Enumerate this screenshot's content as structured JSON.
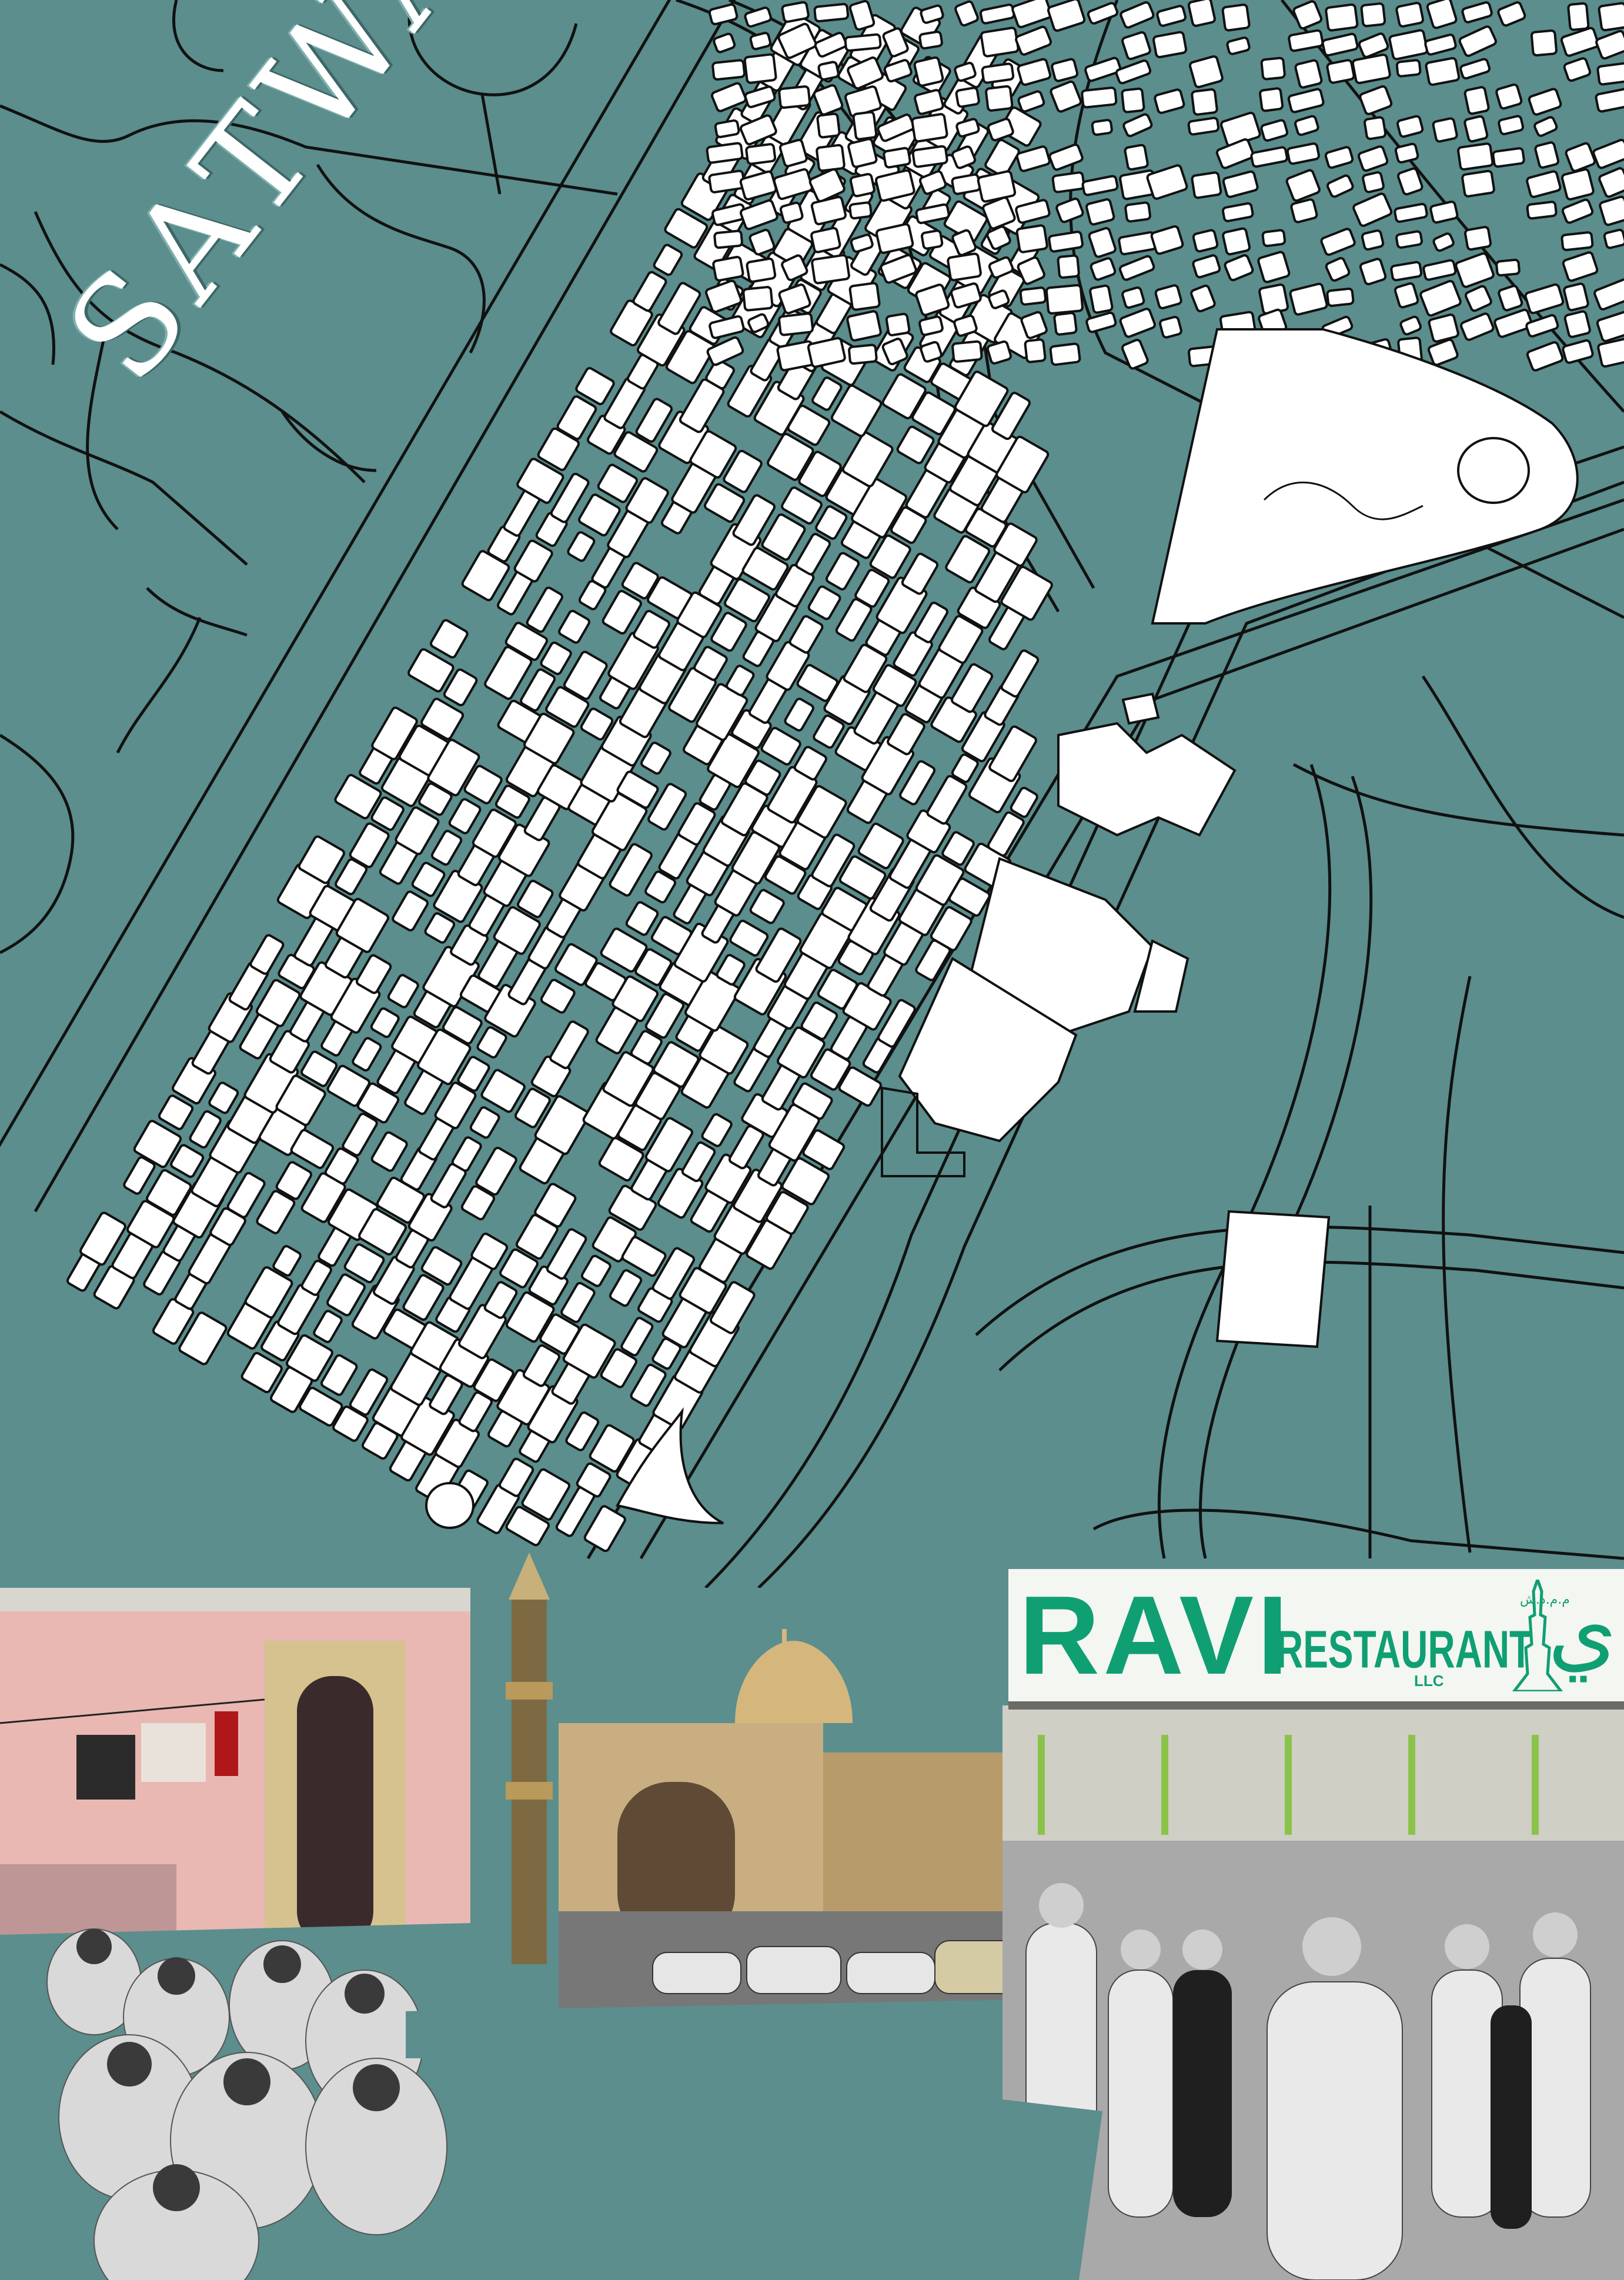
{
  "title": "SATWA",
  "colors": {
    "background": "#5b8e8d",
    "blocks": "#ffffff",
    "roads": "#111111",
    "sign_text": "#0f9f73"
  },
  "sign": {
    "name": "RAVI",
    "subtitle": "RESTAURANT",
    "suffix": "LLC",
    "arabic_large": "ي",
    "arabic_small": "م.م.ذ.ش"
  },
  "icons": [
    "minaret-icon",
    "tower-logo-icon"
  ]
}
